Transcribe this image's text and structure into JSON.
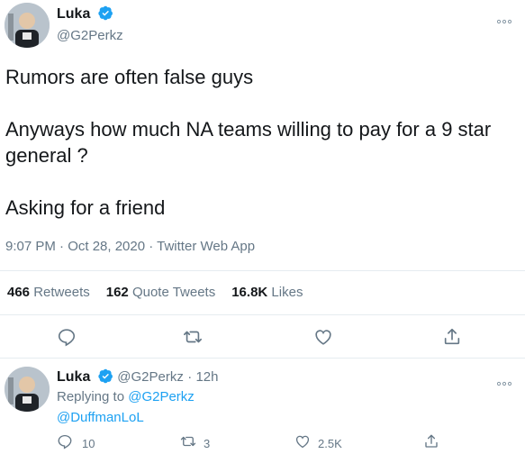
{
  "main_tweet": {
    "author_name": "Luka",
    "author_handle": "@G2Perkz",
    "text": "Rumors are often false guys\n\nAnyways how much NA teams willing to pay for a 9 star general ?\n\nAsking for a friend",
    "timestamp": "9:07 PM · Oct 28, 2020 · Twitter Web App",
    "stats": {
      "retweets_count": "466",
      "retweets_label": "Retweets",
      "quotes_count": "162",
      "quotes_label": "Quote Tweets",
      "likes_count": "16.8K",
      "likes_label": "Likes"
    },
    "actions": [
      "reply-icon",
      "retweet-icon",
      "like-icon",
      "share-icon"
    ]
  },
  "reply_tweet": {
    "author_name": "Luka",
    "author_handle": "@G2Perkz",
    "time_ago": "· 12h",
    "replying_prefix": "Replying to",
    "replying_to_1": "@G2Perkz",
    "replying_to_2": "@DuffmanLoL",
    "reply_count": "10",
    "retweet_count": "3",
    "like_count": "2.5K"
  },
  "colors": {
    "accent": "#1da1f2",
    "muted": "#657786",
    "text": "#14171a",
    "divider": "#e6ecf0"
  }
}
